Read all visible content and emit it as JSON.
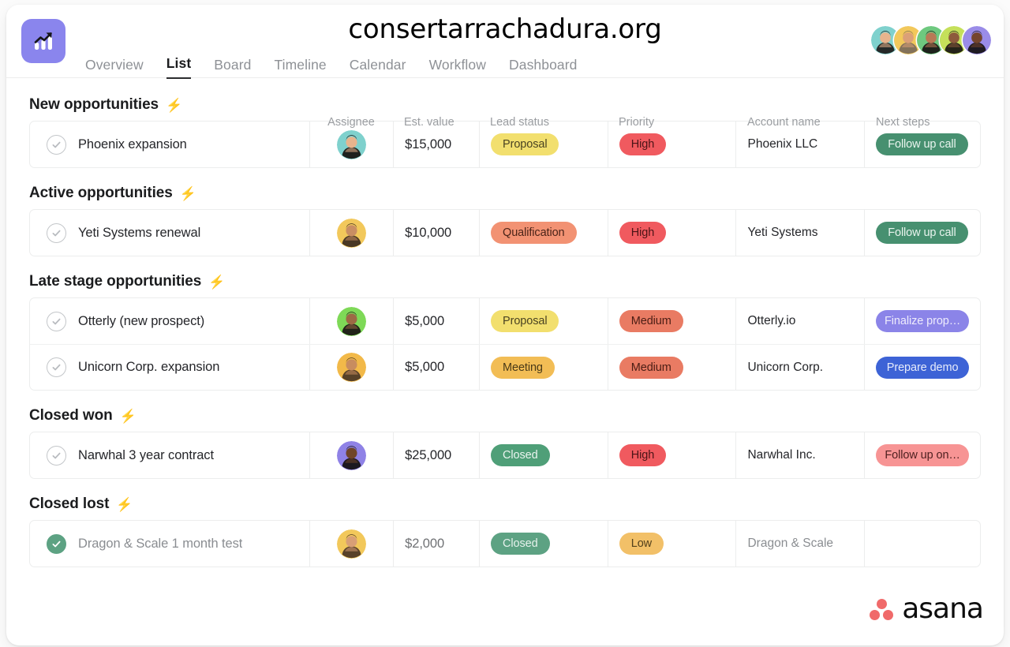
{
  "header": {
    "site_title": "consertarrachadura.org",
    "app_icon": "chart-growth-icon",
    "tabs": [
      {
        "label": "Overview",
        "active": false
      },
      {
        "label": "List",
        "active": true
      },
      {
        "label": "Board",
        "active": false
      },
      {
        "label": "Timeline",
        "active": false
      },
      {
        "label": "Calendar",
        "active": false
      },
      {
        "label": "Workflow",
        "active": false
      },
      {
        "label": "Dashboard",
        "active": false
      }
    ],
    "avatars": [
      {
        "name": "member-avatar-1",
        "bg": "#7fd1cd",
        "skin": "#e8b48d",
        "hair": "#1d1a1a"
      },
      {
        "name": "member-avatar-2",
        "bg": "#f2c85b",
        "skin": "#dba077",
        "hair": "#7a6a5a"
      },
      {
        "name": "member-avatar-3",
        "bg": "#6ec97f",
        "skin": "#b87a56",
        "hair": "#171313"
      },
      {
        "name": "member-avatar-4",
        "bg": "#c5e05a",
        "skin": "#8d5a3c",
        "hair": "#171313"
      },
      {
        "name": "member-avatar-5",
        "bg": "#9a8ce8",
        "skin": "#74452c",
        "hair": "#141010"
      }
    ]
  },
  "columns": [
    {
      "key": "task",
      "label": ""
    },
    {
      "key": "assignee",
      "label": "Assignee"
    },
    {
      "key": "value",
      "label": "Est. value"
    },
    {
      "key": "lead",
      "label": "Lead status"
    },
    {
      "key": "priority",
      "label": "Priority"
    },
    {
      "key": "account",
      "label": "Account name"
    },
    {
      "key": "next",
      "label": "Next steps"
    }
  ],
  "sections": [
    {
      "title": "New opportunities",
      "icon": "lightning-bolt-icon",
      "rows": [
        {
          "task": "Phoenix expansion",
          "done": false,
          "avatar": {
            "bg": "#7fd1cd",
            "skin": "#e8b48d",
            "hair": "#16110f"
          },
          "value": "$15,000",
          "lead": {
            "text": "Proposal",
            "bg": "#f2df6e",
            "fg": "#4a4322"
          },
          "priority": {
            "text": "High",
            "bg": "#f05a5f",
            "fg": "#4a1416"
          },
          "account": "Phoenix LLC",
          "next": {
            "text": "Follow up call",
            "bg": "#479070",
            "fg": "#e9f4ee"
          }
        }
      ]
    },
    {
      "title": "Active opportunities",
      "icon": "lightning-bolt-icon",
      "rows": [
        {
          "task": "Yeti Systems renewal",
          "done": false,
          "avatar": {
            "bg": "#f2c85b",
            "skin": "#c98e63",
            "hair": "#3b2b20"
          },
          "value": "$10,000",
          "lead": {
            "text": "Qualification",
            "bg": "#f29273",
            "fg": "#4a2318"
          },
          "priority": {
            "text": "High",
            "bg": "#f05a5f",
            "fg": "#4a1416"
          },
          "account": "Yeti Systems",
          "next": {
            "text": "Follow up call",
            "bg": "#479070",
            "fg": "#e9f4ee"
          }
        }
      ]
    },
    {
      "title": "Late stage opportunities",
      "icon": "lightning-bolt-icon",
      "rows": [
        {
          "task": "Otterly (new prospect)",
          "done": false,
          "avatar": {
            "bg": "#7ed957",
            "skin": "#9c6a45",
            "hair": "#191414"
          },
          "value": "$5,000",
          "lead": {
            "text": "Proposal",
            "bg": "#f2df6e",
            "fg": "#4a4322"
          },
          "priority": {
            "text": "Medium",
            "bg": "#e97b63",
            "fg": "#4a1d14"
          },
          "account": "Otterly.io",
          "next": {
            "text": "Finalize prop…",
            "bg": "#8b84e8",
            "fg": "#eeecfc"
          }
        },
        {
          "task": "Unicorn Corp. expansion",
          "done": false,
          "avatar": {
            "bg": "#f2b949",
            "skin": "#c88c5f",
            "hair": "#4a3626"
          },
          "value": "$5,000",
          "lead": {
            "text": "Meeting",
            "bg": "#f2bd55",
            "fg": "#4a3a18"
          },
          "priority": {
            "text": "Medium",
            "bg": "#e97b63",
            "fg": "#4a1d14"
          },
          "account": "Unicorn Corp.",
          "next": {
            "text": "Prepare demo",
            "bg": "#3d63d6",
            "fg": "#e6ebfb"
          }
        }
      ]
    },
    {
      "title": "Closed won",
      "icon": "lightning-bolt-icon",
      "rows": [
        {
          "task": "Narwhal 3 year contract",
          "done": false,
          "avatar": {
            "bg": "#8f82e6",
            "skin": "#6f4529",
            "hair": "#120f0f"
          },
          "value": "$25,000",
          "lead": {
            "text": "Closed",
            "bg": "#4f9f78",
            "fg": "#eaf4ef"
          },
          "priority": {
            "text": "High",
            "bg": "#f05a5f",
            "fg": "#4a1416"
          },
          "account": "Narwhal Inc.",
          "next": {
            "text": "Follow up on…",
            "bg": "#f79494",
            "fg": "#4d1f1f"
          }
        }
      ]
    },
    {
      "title": "Closed lost",
      "icon": "lightning-bolt-icon",
      "rows": [
        {
          "task": "Dragon & Scale 1 month test",
          "done": true,
          "avatar": {
            "bg": "#f2c85b",
            "skin": "#d89f76",
            "hair": "#4b3525"
          },
          "value": "$2,000",
          "lead": {
            "text": "Closed",
            "bg": "#5da283",
            "fg": "#e6f1ec"
          },
          "priority": {
            "text": "Low",
            "bg": "#f2c068",
            "fg": "#53401c"
          },
          "account": "Dragon & Scale",
          "next": {
            "text": "",
            "bg": "transparent",
            "fg": "transparent"
          }
        }
      ]
    }
  ],
  "watermark": {
    "brand": "asana",
    "logo": "asana-dots-logo"
  }
}
